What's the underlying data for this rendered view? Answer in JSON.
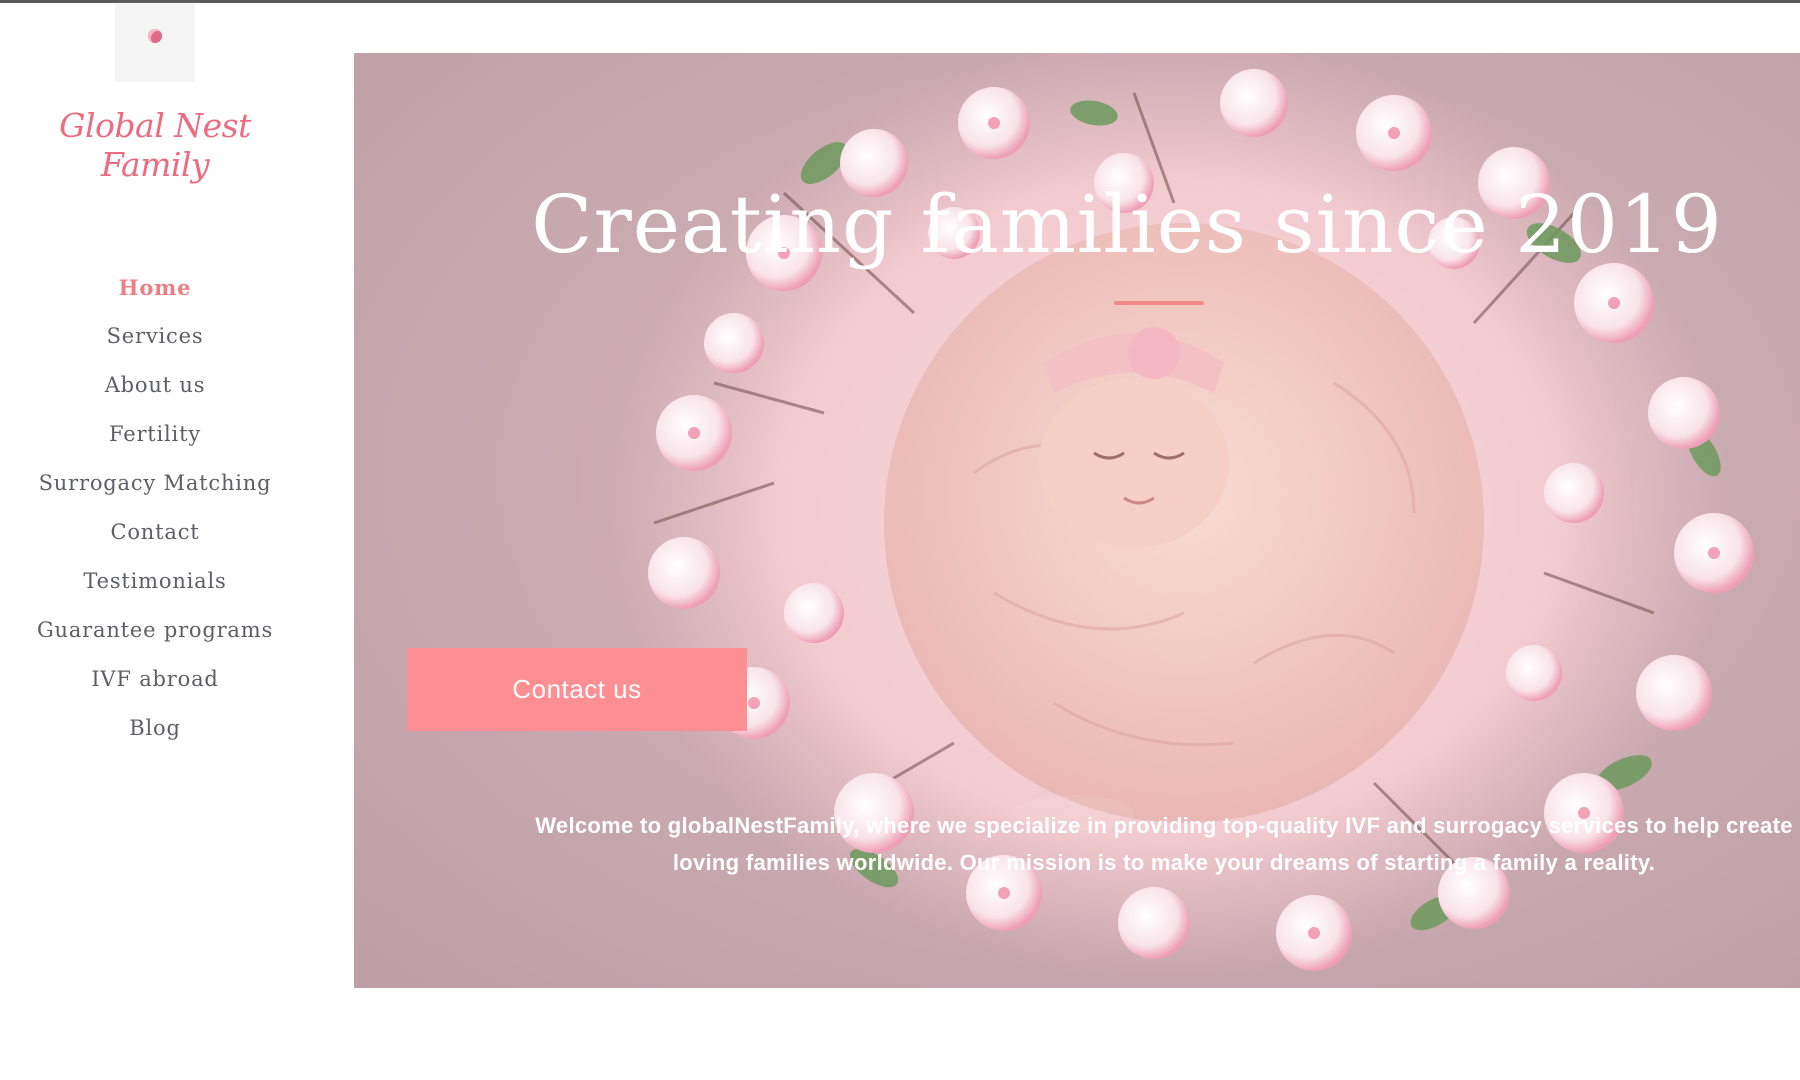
{
  "brand": {
    "name": "Global Nest Family",
    "logo_icon": "rose-dot-icon"
  },
  "nav": {
    "items": [
      {
        "label": "Home",
        "active": true
      },
      {
        "label": "Services",
        "active": false
      },
      {
        "label": "About us",
        "active": false
      },
      {
        "label": "Fertility",
        "active": false
      },
      {
        "label": "Surrogacy Matching",
        "active": false
      },
      {
        "label": "Contact",
        "active": false
      },
      {
        "label": "Testimonials",
        "active": false
      },
      {
        "label": "Guarantee programs",
        "active": false
      },
      {
        "label": "IVF abroad",
        "active": false
      },
      {
        "label": "Blog",
        "active": false
      }
    ]
  },
  "hero": {
    "title": "Creating families since 2019",
    "cta_label": "Contact us",
    "description": "Welcome to globalNestFamily, where we specialize in providing top-quality IVF and surrogacy services to help create loving families worldwide. Our mission is to make your dreams of starting a family a reality.",
    "image": "newborn-in-flower-nest-photo"
  },
  "colors": {
    "accent": "#fd8f92",
    "brand": "#ec6b7f",
    "nav_text": "#5d5e66",
    "hero_bg": "#c9a9b0"
  }
}
